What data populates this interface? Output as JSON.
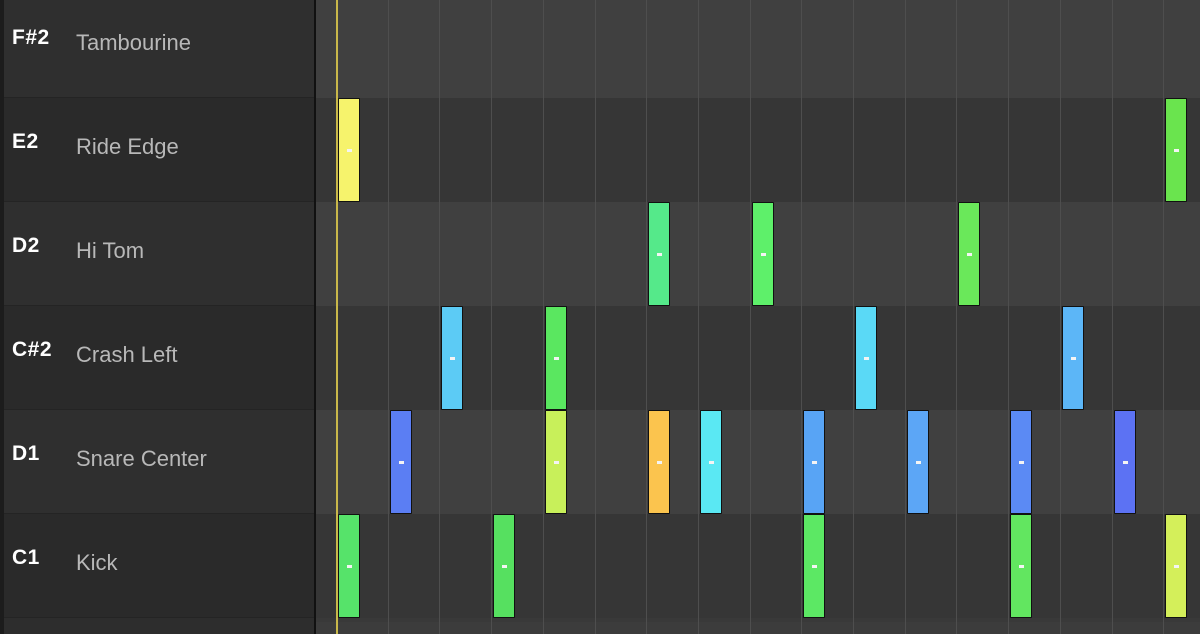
{
  "drum_rows": [
    {
      "note": "F#2",
      "name": "Tambourine"
    },
    {
      "note": "E2",
      "name": "Ride Edge"
    },
    {
      "note": "D2",
      "name": "Hi Tom"
    },
    {
      "note": "C#2",
      "name": "Crash Left"
    },
    {
      "note": "D1",
      "name": "Snare Center"
    },
    {
      "note": "C1",
      "name": "Kick"
    }
  ],
  "grid": {
    "steps_visible": 17
  },
  "notes": [
    {
      "row": 1,
      "step": 0,
      "color": "#f6f36c"
    },
    {
      "row": 1,
      "step": 16,
      "color": "#6ae44e"
    },
    {
      "row": 2,
      "step": 6,
      "color": "#55e98a"
    },
    {
      "row": 2,
      "step": 8,
      "color": "#5ef06a"
    },
    {
      "row": 2,
      "step": 12,
      "color": "#6ae85a"
    },
    {
      "row": 3,
      "step": 2,
      "color": "#5ccbf5"
    },
    {
      "row": 3,
      "step": 4,
      "color": "#5ae760"
    },
    {
      "row": 3,
      "step": 10,
      "color": "#5ad9f6"
    },
    {
      "row": 3,
      "step": 14,
      "color": "#5cb6f7"
    },
    {
      "row": 4,
      "step": 1,
      "color": "#5b7ef3"
    },
    {
      "row": 4,
      "step": 4,
      "color": "#c8f05a"
    },
    {
      "row": 4,
      "step": 6,
      "color": "#fbc44e"
    },
    {
      "row": 4,
      "step": 7,
      "color": "#5ae8f3"
    },
    {
      "row": 4,
      "step": 9,
      "color": "#58a4f5"
    },
    {
      "row": 4,
      "step": 11,
      "color": "#5ca6f6"
    },
    {
      "row": 4,
      "step": 13,
      "color": "#5b8af4"
    },
    {
      "row": 4,
      "step": 15,
      "color": "#5c72f3"
    },
    {
      "row": 5,
      "step": 0,
      "color": "#56e36a"
    },
    {
      "row": 5,
      "step": 3,
      "color": "#56e060"
    },
    {
      "row": 5,
      "step": 9,
      "color": "#5ce864"
    },
    {
      "row": 5,
      "step": 13,
      "color": "#62e660"
    },
    {
      "row": 5,
      "step": 16,
      "color": "#d4ef5a"
    }
  ]
}
